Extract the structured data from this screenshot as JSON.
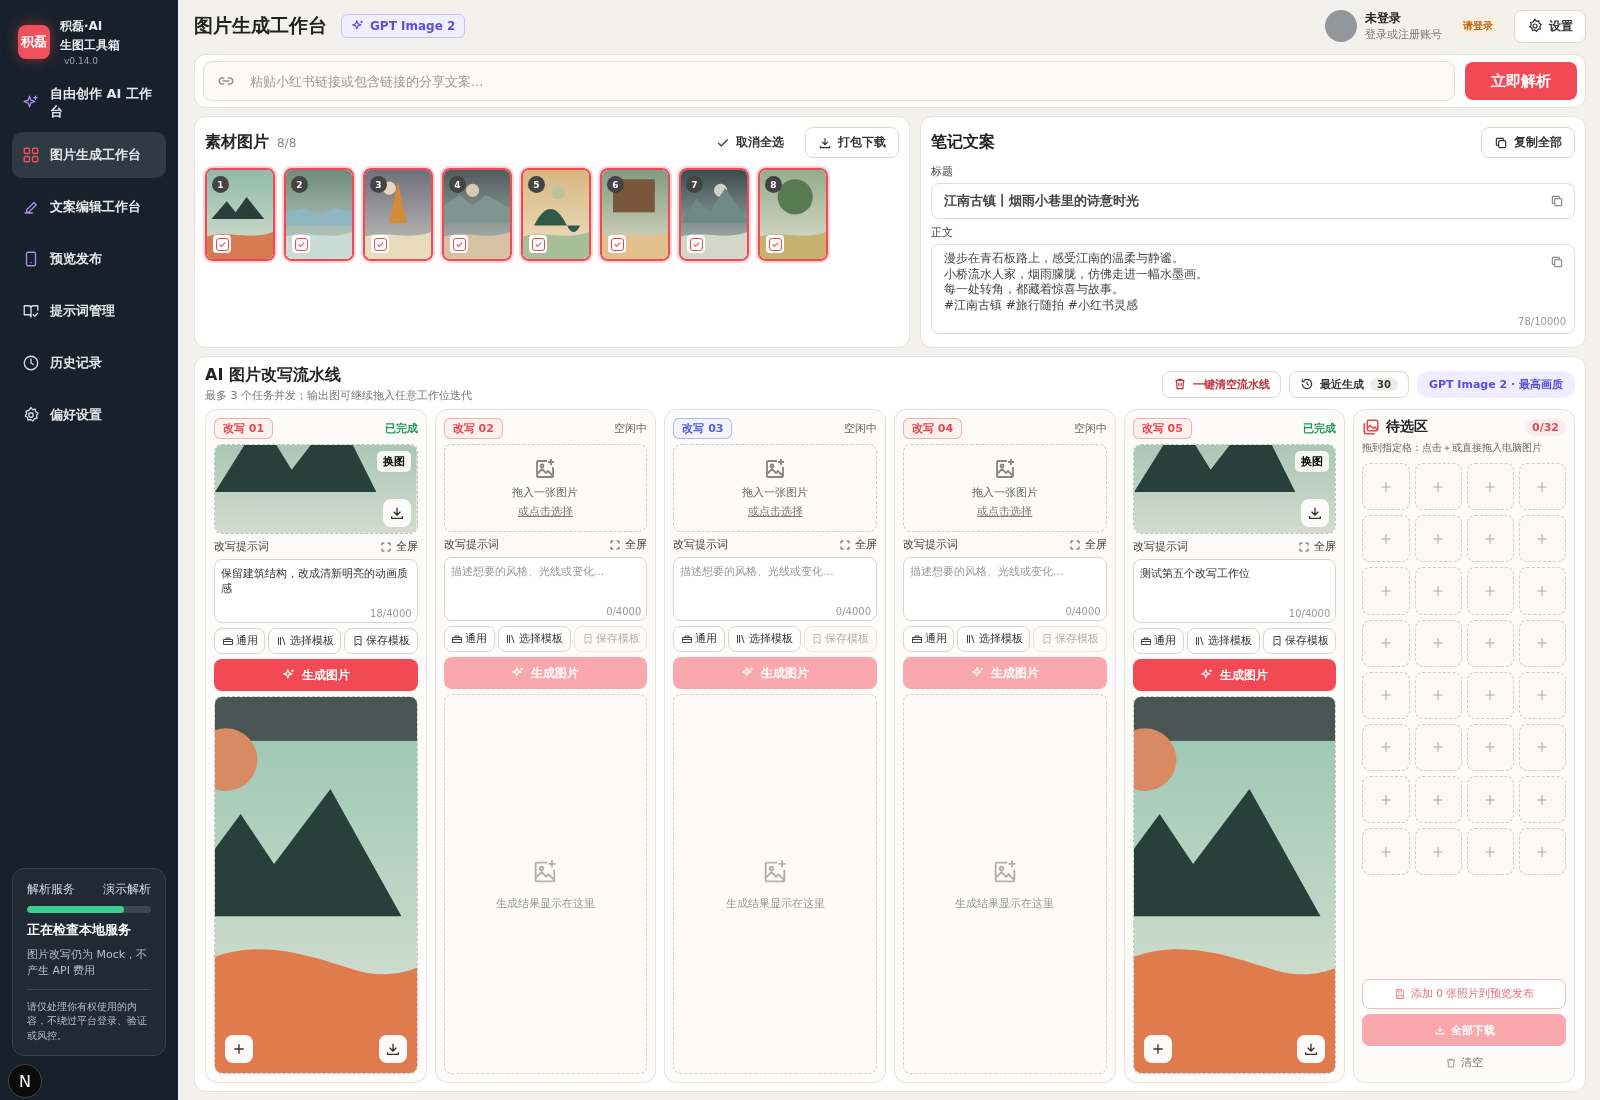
{
  "sidebar": {
    "logo": "积磊",
    "brand": "积磊·AI",
    "subtitle": "生图工具箱",
    "version": "v0.14.0",
    "items": [
      {
        "label": "自由创作 AI 工作台",
        "selected": false
      },
      {
        "label": "图片生成工作台",
        "selected": true
      },
      {
        "label": "文案编辑工作台",
        "selected": false
      },
      {
        "label": "预览发布",
        "selected": false
      },
      {
        "label": "提示词管理",
        "selected": false
      },
      {
        "label": "历史记录",
        "selected": false
      },
      {
        "label": "偏好设置",
        "selected": false
      }
    ],
    "service": {
      "label": "解析服务",
      "mode": "演示解析",
      "level": 0.78,
      "title": "正在检查本地服务",
      "note": "图片改写仍为 Mock，不产生 API 费用",
      "disclaimer": "请仅处理你有权使用的内容，不绕过平台登录、验证或风控。"
    },
    "dev_badge": "N"
  },
  "header": {
    "title": "图片生成工作台",
    "model_badge": "GPT Image 2",
    "user": {
      "name": "未登录",
      "hint": "登录或注册账号",
      "badge": "请登录"
    },
    "settings": "设置"
  },
  "link_bar": {
    "placeholder": "粘贴小红书链接或包含链接的分享文案...",
    "submit": "立即解析"
  },
  "materials": {
    "title": "素材图片",
    "count": "8/8",
    "deselect": "取消全选",
    "download": "打包下载",
    "images": [
      {
        "number": "1",
        "selected": true
      },
      {
        "number": "2",
        "selected": true
      },
      {
        "number": "3",
        "selected": true
      },
      {
        "number": "4",
        "selected": true
      },
      {
        "number": "5",
        "selected": true
      },
      {
        "number": "6",
        "selected": true
      },
      {
        "number": "7",
        "selected": true
      },
      {
        "number": "8",
        "selected": true
      }
    ]
  },
  "notes": {
    "title": "笔记文案",
    "copy_all": "复制全部",
    "title_label": "标题",
    "title_value": "江南古镇丨烟雨小巷里的诗意时光",
    "body_label": "正文",
    "body_lines": [
      "漫步在青石板路上，感受江南的温柔与静谧。",
      "小桥流水人家，烟雨朦胧，仿佛走进一幅水墨画。",
      "每一处转角，都藏着惊喜与故事。",
      "#江南古镇 #旅行随拍 #小红书灵感"
    ],
    "counter": "78/10000"
  },
  "pipeline": {
    "title": "AI 图片改写流水线",
    "subtitle": "最多 3 个任务并发；输出图可继续拖入任意工作位迭代",
    "clear": "一键清空流水线",
    "recent": "最近生成",
    "recent_count": "30",
    "quality": "GPT Image 2 · 最高画质",
    "slots": [
      {
        "label": "改写 01",
        "color": "#e5484d",
        "kind": "done",
        "status": "已完成",
        "swap": "换图",
        "prompt_label": "改写提示词",
        "fullscreen": "全屏",
        "prompt": "保留建筑结构，改成清新明亮的动画质感",
        "counter": "18/4000",
        "tools": [
          {
            "label": "通用",
            "disabled": false
          },
          {
            "label": "选择模板",
            "disabled": false
          },
          {
            "label": "保存模板",
            "disabled": false
          }
        ],
        "generate": {
          "label": "生成图片",
          "disabled": false
        },
        "result": {
          "kind": "picture"
        }
      },
      {
        "label": "改写 02",
        "color": "#e5484d",
        "kind": "idle",
        "status": "空闲中",
        "drop_title": "拖入一张图片",
        "drop_link": "或点击选择",
        "prompt_label": "改写提示词",
        "fullscreen": "全屏",
        "placeholder": "描述想要的风格、光线或变化...",
        "counter": "0/4000",
        "tools": [
          {
            "label": "通用",
            "disabled": false
          },
          {
            "label": "选择模板",
            "disabled": false
          },
          {
            "label": "保存模板",
            "disabled": true
          }
        ],
        "generate": {
          "label": "生成图片",
          "disabled": true
        },
        "result": {
          "kind": "empty",
          "text": "生成结果显示在这里"
        }
      },
      {
        "label": "改写 03",
        "color": "#4f63e0",
        "kind": "idle",
        "status": "空闲中",
        "drop_title": "拖入一张图片",
        "drop_link": "或点击选择",
        "prompt_label": "改写提示词",
        "fullscreen": "全屏",
        "placeholder": "描述想要的风格、光线或变化...",
        "counter": "0/4000",
        "tools": [
          {
            "label": "通用",
            "disabled": false
          },
          {
            "label": "选择模板",
            "disabled": false
          },
          {
            "label": "保存模板",
            "disabled": true
          }
        ],
        "generate": {
          "label": "生成图片",
          "disabled": true
        },
        "result": {
          "kind": "empty",
          "text": "生成结果显示在这里"
        }
      },
      {
        "label": "改写 04",
        "color": "#e5484d",
        "kind": "idle",
        "status": "空闲中",
        "drop_title": "拖入一张图片",
        "drop_link": "或点击选择",
        "prompt_label": "改写提示词",
        "fullscreen": "全屏",
        "placeholder": "描述想要的风格、光线或变化...",
        "counter": "0/4000",
        "tools": [
          {
            "label": "通用",
            "disabled": false
          },
          {
            "label": "选择模板",
            "disabled": false
          },
          {
            "label": "保存模板",
            "disabled": true
          }
        ],
        "generate": {
          "label": "生成图片",
          "disabled": true
        },
        "result": {
          "kind": "empty",
          "text": "生成结果显示在这里"
        }
      },
      {
        "label": "改写 05",
        "color": "#e5484d",
        "kind": "done",
        "status": "已完成",
        "swap": "换图",
        "prompt_label": "改写提示词",
        "fullscreen": "全屏",
        "prompt": "测试第五个改写工作位",
        "counter": "10/4000",
        "tools": [
          {
            "label": "通用",
            "disabled": false
          },
          {
            "label": "选择模板",
            "disabled": false
          },
          {
            "label": "保存模板",
            "disabled": false
          }
        ],
        "generate": {
          "label": "生成图片",
          "disabled": false
        },
        "result": {
          "kind": "picture"
        }
      }
    ],
    "staging": {
      "title": "待选区",
      "count": "0/32",
      "hint": "拖到指定格：点击＋或直接拖入电脑图片",
      "cells": [
        {
          "kind": "empty"
        },
        {
          "kind": "empty"
        },
        {
          "kind": "empty"
        },
        {
          "kind": "empty"
        },
        {
          "kind": "empty"
        },
        {
          "kind": "empty"
        },
        {
          "kind": "empty"
        },
        {
          "kind": "empty"
        },
        {
          "kind": "empty"
        },
        {
          "kind": "empty"
        },
        {
          "kind": "empty"
        },
        {
          "kind": "empty"
        },
        {
          "kind": "empty"
        },
        {
          "kind": "empty"
        },
        {
          "kind": "empty"
        },
        {
          "kind": "empty"
        },
        {
          "kind": "empty"
        },
        {
          "kind": "empty"
        },
        {
          "kind": "empty"
        },
        {
          "kind": "empty"
        },
        {
          "kind": "empty"
        },
        {
          "kind": "empty"
        },
        {
          "kind": "empty"
        },
        {
          "kind": "empty"
        },
        {
          "kind": "empty"
        },
        {
          "kind": "empty"
        },
        {
          "kind": "empty"
        },
        {
          "kind": "empty"
        },
        {
          "kind": "empty"
        },
        {
          "kind": "empty"
        },
        {
          "kind": "empty"
        },
        {
          "kind": "empty"
        }
      ],
      "add": "添加 0 张照片到预览发布",
      "download_all": "全部下载",
      "clear": "清空"
    }
  }
}
